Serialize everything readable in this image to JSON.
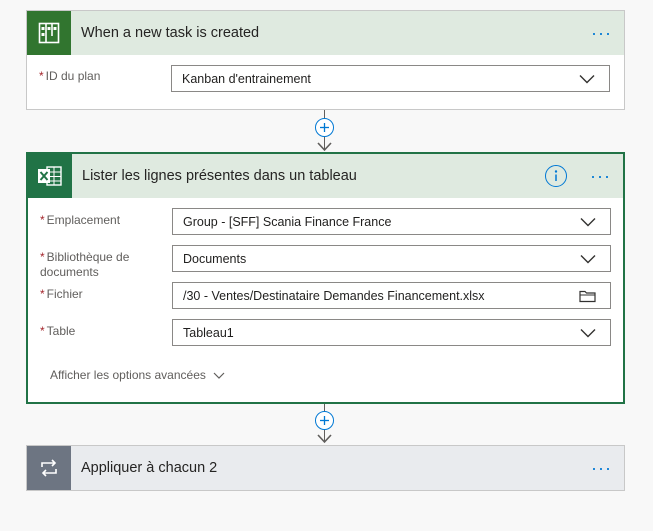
{
  "trigger": {
    "title": "When a new task is created",
    "icon": "planner-icon",
    "color": "#31752f",
    "header_bg": "#dfeae0",
    "fields": [
      {
        "label": "ID du plan",
        "required": true,
        "value": "Kanban d'entrainement",
        "control": "dropdown"
      }
    ]
  },
  "action": {
    "title": "Lister les lignes présentes dans un tableau",
    "icon": "excel-icon",
    "color": "#217346",
    "header_bg": "#dfeae0",
    "border_color": "#217346",
    "fields": [
      {
        "label": "Emplacement",
        "required": true,
        "value": "Group - [SFF] Scania Finance France",
        "control": "dropdown"
      },
      {
        "label": "Bibliothèque de documents",
        "required": true,
        "value": "Documents",
        "control": "dropdown"
      },
      {
        "label": "Fichier",
        "required": true,
        "value": "/30 - Ventes/Destinataire Demandes Financement.xlsx",
        "control": "file-picker"
      },
      {
        "label": "Table",
        "required": true,
        "value": "Tableau1",
        "control": "dropdown"
      }
    ],
    "advanced_label": "Afficher les options avancées"
  },
  "loop": {
    "title": "Appliquer à chacun 2",
    "icon": "loop-icon",
    "color": "#6d7582",
    "header_bg": "#e9ebee"
  },
  "more_glyph": "···",
  "accent": "#0078d4"
}
